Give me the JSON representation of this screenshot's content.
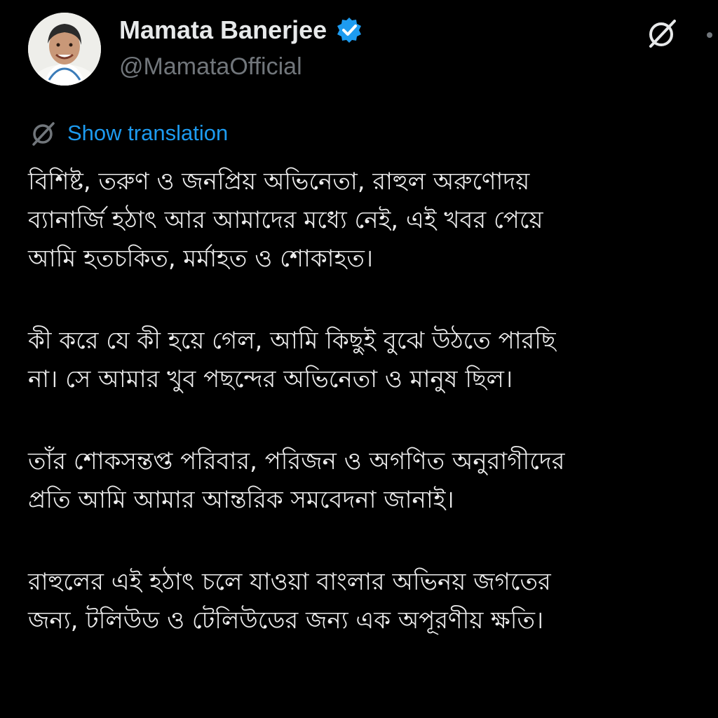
{
  "author": {
    "display_name": "Mamata Banerjee",
    "handle": "@MamataOfficial",
    "verified_icon": "verified-badge-icon",
    "verified_color": "#1d9bf0"
  },
  "actions": {
    "grok_icon": "grok-icon",
    "more_icon": "more-options-icon"
  },
  "translation": {
    "icon": "translate-icon",
    "label": "Show translation",
    "color": "#1d9bf0"
  },
  "tweet": {
    "paragraphs": [
      [
        "বিশিষ্ট, তরুণ ও জনপ্রিয় অভিনেতা, রাহুল অরুণোদয়",
        "ব্যানার্জি হঠাৎ আর আমাদের মধ্যে নেই, এই খবর পেয়ে",
        "আমি হতচকিত, মর্মাহত ও শোকাহত।"
      ],
      [
        "কী করে যে কী হয়ে গেল, আমি কিছুই বুঝে উঠতে পারছি",
        "না। সে আমার খুব পছন্দের অভিনেতা ও মানুষ ছিল।"
      ],
      [
        "তাঁর শোকসন্তপ্ত পরিবার, পরিজন ও অগণিত অনুরাগীদের",
        "প্রতি আমি আমার আন্তরিক সমবেদনা জানাই।"
      ],
      [
        "রাহুলের এই হঠাৎ চলে যাওয়া বাংলার অভিনয় জগতের",
        "জন্য, টলিউড ও টেলিউডের জন্য এক অপূরণীয় ক্ষতি।"
      ]
    ]
  },
  "colors": {
    "background": "#000000",
    "text": "#e7e9ea",
    "secondary": "#71767b",
    "accent": "#1d9bf0"
  }
}
